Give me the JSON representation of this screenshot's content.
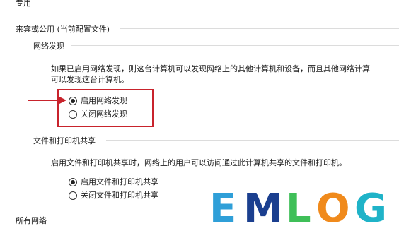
{
  "sections": {
    "private_label": "专用",
    "guest_public_label": "来宾或公用 (当前配置文件)",
    "all_networks_label": "所有网络"
  },
  "network_discovery": {
    "title": "网络发现",
    "desc_line1": "如果已启用网络发现，则这台计算机可以发现网络上的其他计算机和设备，而且其他网络计算",
    "desc_line2": "可以发现这台计算机。",
    "option_on": "启用网络发现",
    "option_off": "关闭网络发现",
    "selected": "on"
  },
  "file_sharing": {
    "title": "文件和打印机共享",
    "desc": "启用文件和打印机共享时，网络上的用户可以访问通过此计算机共享的文件和打印机。",
    "option_on": "启用文件和打印机共享",
    "option_off": "关闭文件和打印机共享",
    "selected": "on"
  },
  "watermark": {
    "letters": [
      "E",
      "M",
      "L",
      "O",
      "G"
    ],
    "colors": [
      "#2f9fd8",
      "#1b3f8f",
      "#3fbf58",
      "#f08a1c",
      "#1fb3c8"
    ]
  }
}
